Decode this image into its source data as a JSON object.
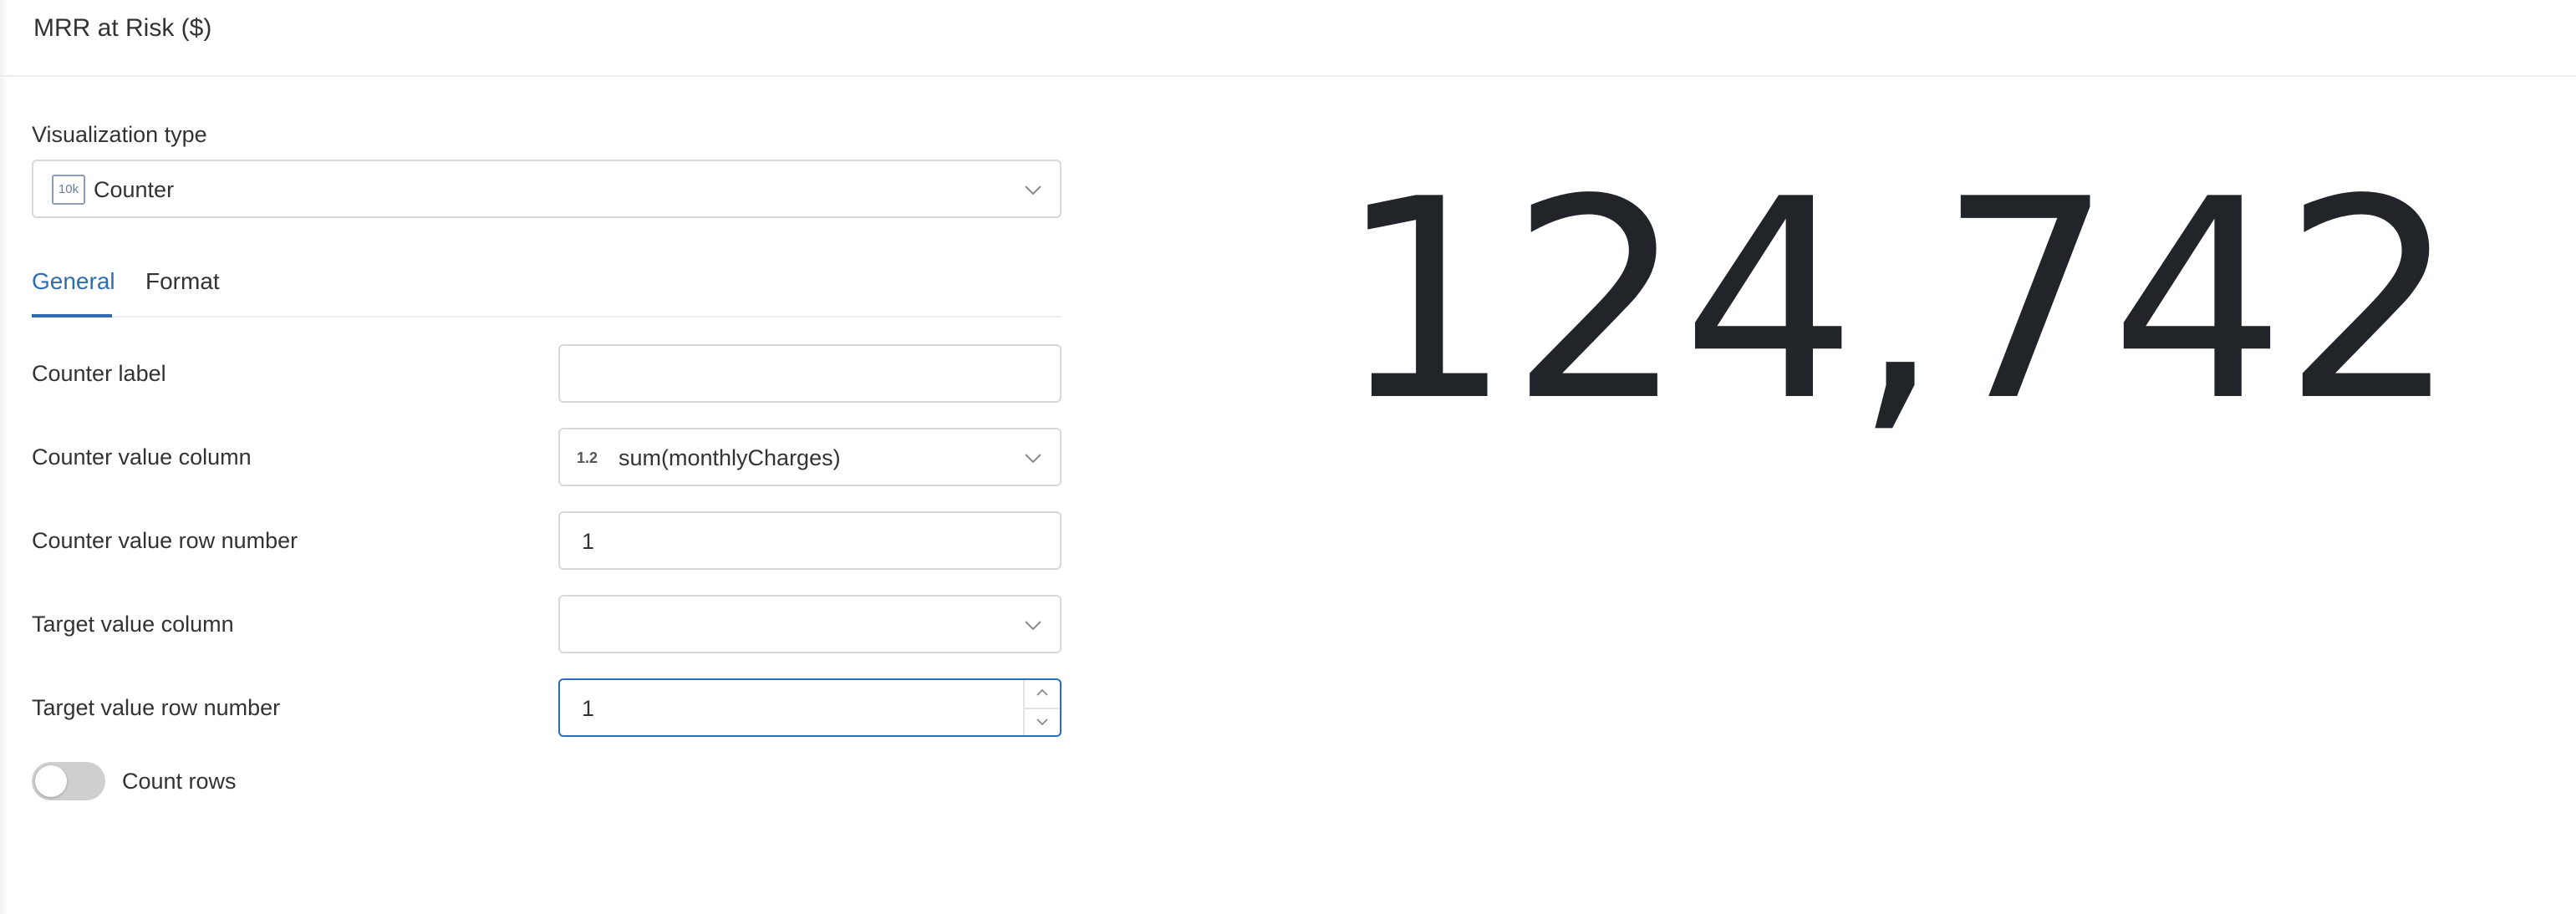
{
  "header": {
    "title": "MRR at Risk ($)"
  },
  "visualization": {
    "label": "Visualization type",
    "icon": "10k",
    "selected": "Counter"
  },
  "tabs": [
    {
      "label": "General",
      "active": true
    },
    {
      "label": "Format",
      "active": false
    }
  ],
  "fields": {
    "counter_label": {
      "label": "Counter label",
      "value": ""
    },
    "counter_value_column": {
      "label": "Counter value column",
      "type_badge": "1.2",
      "value": "sum(monthlyCharges)"
    },
    "counter_value_row": {
      "label": "Counter value row number",
      "value": "1"
    },
    "target_value_column": {
      "label": "Target value column",
      "value": ""
    },
    "target_value_row": {
      "label": "Target value row number",
      "value": "1"
    }
  },
  "count_rows": {
    "label": "Count rows",
    "enabled": false
  },
  "counter": {
    "value": "124,742"
  },
  "colors": {
    "accent": "#2f6db1",
    "text": "#21252a",
    "border": "#d9d9d9"
  }
}
